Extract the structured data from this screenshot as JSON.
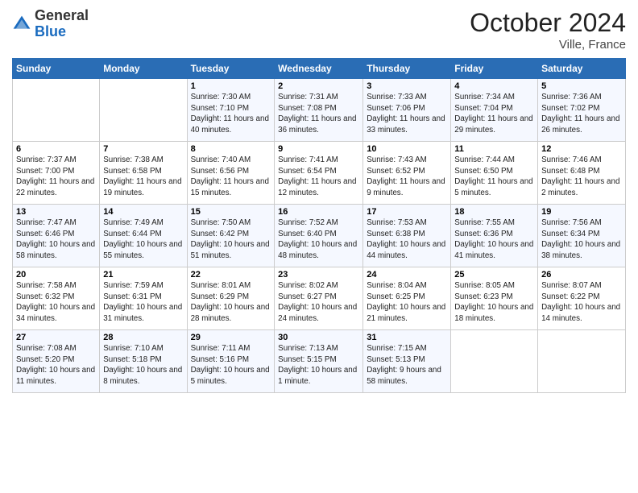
{
  "header": {
    "logo_general": "General",
    "logo_blue": "Blue",
    "month_title": "October 2024",
    "location": "Ville, France"
  },
  "days_of_week": [
    "Sunday",
    "Monday",
    "Tuesday",
    "Wednesday",
    "Thursday",
    "Friday",
    "Saturday"
  ],
  "weeks": [
    [
      {
        "day": "",
        "info": ""
      },
      {
        "day": "",
        "info": ""
      },
      {
        "day": "1",
        "info": "Sunrise: 7:30 AM\nSunset: 7:10 PM\nDaylight: 11 hours and 40 minutes."
      },
      {
        "day": "2",
        "info": "Sunrise: 7:31 AM\nSunset: 7:08 PM\nDaylight: 11 hours and 36 minutes."
      },
      {
        "day": "3",
        "info": "Sunrise: 7:33 AM\nSunset: 7:06 PM\nDaylight: 11 hours and 33 minutes."
      },
      {
        "day": "4",
        "info": "Sunrise: 7:34 AM\nSunset: 7:04 PM\nDaylight: 11 hours and 29 minutes."
      },
      {
        "day": "5",
        "info": "Sunrise: 7:36 AM\nSunset: 7:02 PM\nDaylight: 11 hours and 26 minutes."
      }
    ],
    [
      {
        "day": "6",
        "info": "Sunrise: 7:37 AM\nSunset: 7:00 PM\nDaylight: 11 hours and 22 minutes."
      },
      {
        "day": "7",
        "info": "Sunrise: 7:38 AM\nSunset: 6:58 PM\nDaylight: 11 hours and 19 minutes."
      },
      {
        "day": "8",
        "info": "Sunrise: 7:40 AM\nSunset: 6:56 PM\nDaylight: 11 hours and 15 minutes."
      },
      {
        "day": "9",
        "info": "Sunrise: 7:41 AM\nSunset: 6:54 PM\nDaylight: 11 hours and 12 minutes."
      },
      {
        "day": "10",
        "info": "Sunrise: 7:43 AM\nSunset: 6:52 PM\nDaylight: 11 hours and 9 minutes."
      },
      {
        "day": "11",
        "info": "Sunrise: 7:44 AM\nSunset: 6:50 PM\nDaylight: 11 hours and 5 minutes."
      },
      {
        "day": "12",
        "info": "Sunrise: 7:46 AM\nSunset: 6:48 PM\nDaylight: 11 hours and 2 minutes."
      }
    ],
    [
      {
        "day": "13",
        "info": "Sunrise: 7:47 AM\nSunset: 6:46 PM\nDaylight: 10 hours and 58 minutes."
      },
      {
        "day": "14",
        "info": "Sunrise: 7:49 AM\nSunset: 6:44 PM\nDaylight: 10 hours and 55 minutes."
      },
      {
        "day": "15",
        "info": "Sunrise: 7:50 AM\nSunset: 6:42 PM\nDaylight: 10 hours and 51 minutes."
      },
      {
        "day": "16",
        "info": "Sunrise: 7:52 AM\nSunset: 6:40 PM\nDaylight: 10 hours and 48 minutes."
      },
      {
        "day": "17",
        "info": "Sunrise: 7:53 AM\nSunset: 6:38 PM\nDaylight: 10 hours and 44 minutes."
      },
      {
        "day": "18",
        "info": "Sunrise: 7:55 AM\nSunset: 6:36 PM\nDaylight: 10 hours and 41 minutes."
      },
      {
        "day": "19",
        "info": "Sunrise: 7:56 AM\nSunset: 6:34 PM\nDaylight: 10 hours and 38 minutes."
      }
    ],
    [
      {
        "day": "20",
        "info": "Sunrise: 7:58 AM\nSunset: 6:32 PM\nDaylight: 10 hours and 34 minutes."
      },
      {
        "day": "21",
        "info": "Sunrise: 7:59 AM\nSunset: 6:31 PM\nDaylight: 10 hours and 31 minutes."
      },
      {
        "day": "22",
        "info": "Sunrise: 8:01 AM\nSunset: 6:29 PM\nDaylight: 10 hours and 28 minutes."
      },
      {
        "day": "23",
        "info": "Sunrise: 8:02 AM\nSunset: 6:27 PM\nDaylight: 10 hours and 24 minutes."
      },
      {
        "day": "24",
        "info": "Sunrise: 8:04 AM\nSunset: 6:25 PM\nDaylight: 10 hours and 21 minutes."
      },
      {
        "day": "25",
        "info": "Sunrise: 8:05 AM\nSunset: 6:23 PM\nDaylight: 10 hours and 18 minutes."
      },
      {
        "day": "26",
        "info": "Sunrise: 8:07 AM\nSunset: 6:22 PM\nDaylight: 10 hours and 14 minutes."
      }
    ],
    [
      {
        "day": "27",
        "info": "Sunrise: 7:08 AM\nSunset: 5:20 PM\nDaylight: 10 hours and 11 minutes."
      },
      {
        "day": "28",
        "info": "Sunrise: 7:10 AM\nSunset: 5:18 PM\nDaylight: 10 hours and 8 minutes."
      },
      {
        "day": "29",
        "info": "Sunrise: 7:11 AM\nSunset: 5:16 PM\nDaylight: 10 hours and 5 minutes."
      },
      {
        "day": "30",
        "info": "Sunrise: 7:13 AM\nSunset: 5:15 PM\nDaylight: 10 hours and 1 minute."
      },
      {
        "day": "31",
        "info": "Sunrise: 7:15 AM\nSunset: 5:13 PM\nDaylight: 9 hours and 58 minutes."
      },
      {
        "day": "",
        "info": ""
      },
      {
        "day": "",
        "info": ""
      }
    ]
  ]
}
